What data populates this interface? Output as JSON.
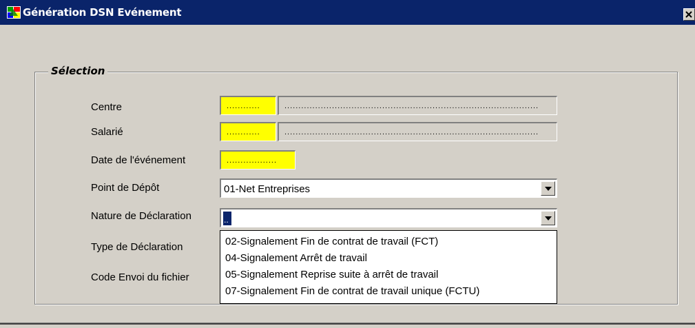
{
  "window": {
    "title": "Génération DSN Evénement",
    "close_label": "×"
  },
  "group": {
    "legend": "Sélection"
  },
  "fields": {
    "centre": {
      "label": "Centre",
      "code": "............",
      "name": "..........................................................................................."
    },
    "salarie": {
      "label": "Salarié",
      "code": "............",
      "name": "..........................................................................................."
    },
    "date_evenement": {
      "label": "Date de l'événement",
      "value": ".................."
    },
    "point_depot": {
      "label": "Point de Dépôt",
      "value": "01-Net Entreprises"
    },
    "nature_declaration": {
      "label": "Nature de Déclaration",
      "value": ".."
    },
    "type_declaration": {
      "label": "Type de Déclaration"
    },
    "code_envoi": {
      "label": "Code Envoi du fichier"
    }
  },
  "dropdown": {
    "options": [
      "02-Signalement Fin de contrat de travail (FCT)",
      "04-Signalement Arrêt de travail",
      "05-Signalement Reprise suite à arrêt de travail",
      "07-Signalement Fin de contrat de travail unique (FCTU)"
    ]
  },
  "colors": {
    "titlebar": "#0a246a",
    "required_field": "#ffff00",
    "window_bg": "#d4d0c8"
  }
}
